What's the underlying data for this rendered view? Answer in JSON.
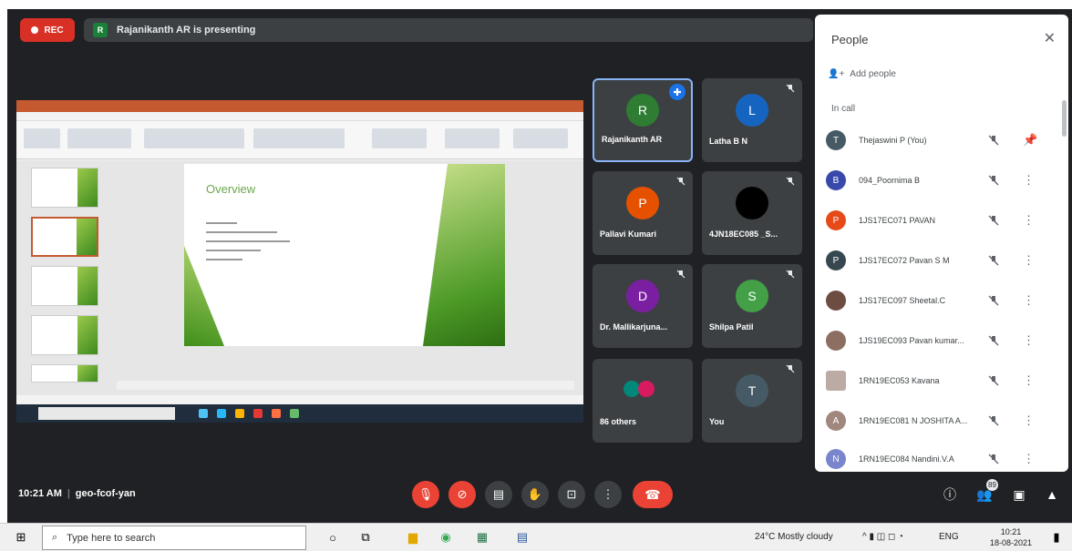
{
  "recording": {
    "label": "REC",
    "color": "#d93025"
  },
  "presenter": {
    "initial": "R",
    "text": "Rajanikanth AR is presenting"
  },
  "shared_screen": {
    "slide_title": "Overview"
  },
  "tiles": [
    {
      "name": "Rajanikanth AR",
      "initial": "R",
      "avatar_color": "#2e7d32",
      "highlighted": true
    },
    {
      "name": "Latha B N",
      "initial": "L",
      "avatar_color": "#1565c0"
    },
    {
      "name": "Pallavi Kumari",
      "initial": "P",
      "avatar_color": "#e65100"
    },
    {
      "name": "4JN18EC085 _S...",
      "initial": "",
      "avatar_color": "#000000"
    },
    {
      "name": "Dr. Mallikarjuna...",
      "initial": "D",
      "avatar_color": "#7b1fa2"
    },
    {
      "name": "Shilpa Patil",
      "initial": "S",
      "avatar_color": "#43a047"
    },
    {
      "name": "86 others",
      "initial": ""
    },
    {
      "name": "You",
      "initial": "T",
      "avatar_color": "#455a64"
    }
  ],
  "people_panel": {
    "title": "People",
    "add_people": "Add people",
    "in_call": "In call",
    "participants": [
      {
        "name": "Thejaswini P (You)",
        "initial": "T",
        "color": "#455a64",
        "action": "pin"
      },
      {
        "name": "094_Poornima B",
        "initial": "B",
        "color": "#3949ab",
        "action": "more"
      },
      {
        "name": "1JS17EC071 PAVAN",
        "initial": "P",
        "color": "#e64a19",
        "action": "more"
      },
      {
        "name": "1JS17EC072 Pavan S M",
        "initial": "P",
        "color": "#37474f",
        "action": "more"
      },
      {
        "name": "1JS17EC097 Sheetal.C",
        "initial": "",
        "color": "#6d4c41",
        "action": "more"
      },
      {
        "name": "1JS19EC093 Pavan kumar...",
        "initial": "",
        "color": "#8d6e63",
        "action": "more"
      },
      {
        "name": "1RN19EC053 Kavana",
        "initial": "",
        "color": "#bcaaa4",
        "action": "more"
      },
      {
        "name": "1RN19EC081 N JOSHITA A...",
        "initial": "A",
        "color": "#a1887f",
        "action": "more"
      },
      {
        "name": "1RN19EC084 Nandini.V.A",
        "initial": "N",
        "color": "#7986cb",
        "action": "more"
      }
    ]
  },
  "meeting": {
    "time": "10:21 AM",
    "code": "geo-fcof-yan",
    "participant_count": "89"
  },
  "taskbar": {
    "search_placeholder": "Type here to search",
    "weather": "24°C Mostly cloudy",
    "lang": "ENG",
    "clock_time": "10:21",
    "clock_date": "18-08-2021"
  }
}
